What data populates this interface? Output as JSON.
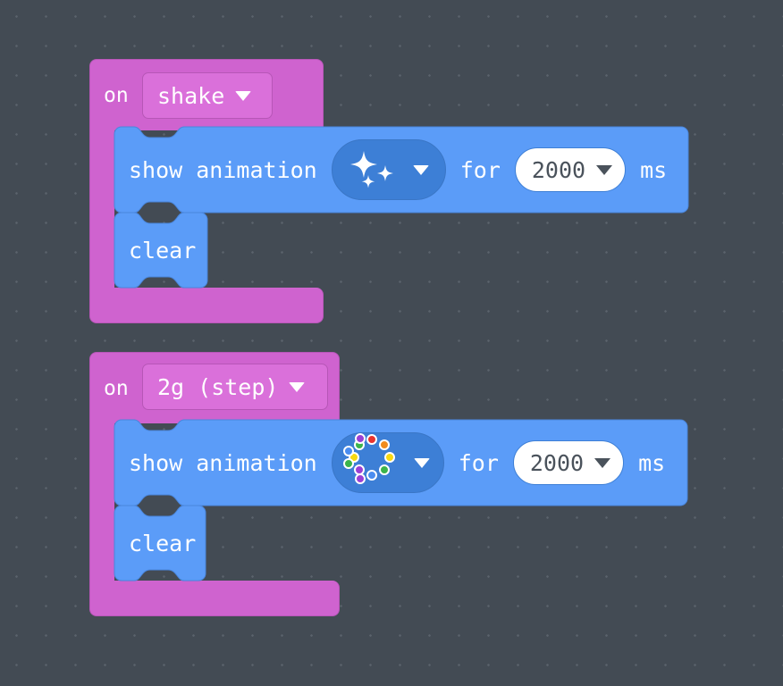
{
  "workspace": {
    "name": "makecode-blocks-workspace",
    "background_color": "#434b54",
    "grid_dot_color": "#5b636c",
    "grid_spacing_px": 33
  },
  "palette": {
    "event_block": "#cf63cf",
    "event_field": "#da70da",
    "statement_block": "#5b9cf8",
    "statement_field": "#3d7fd6",
    "number_field_bg": "#ffffff",
    "number_field_text": "#4a525b",
    "block_text": "#ffffff"
  },
  "scripts": [
    {
      "id": "script-on-shake",
      "event": {
        "prefix_label": "on",
        "selected_event": "shake",
        "dropdown_icon": "chevron-down-icon"
      },
      "statements": [
        {
          "id": "show-animation-sparkles",
          "label_before": "show animation",
          "animation": {
            "name": "sparkle-animation-icon",
            "dropdown_icon": "chevron-down-icon"
          },
          "label_middle": "for",
          "duration_value": "2000",
          "duration_dropdown_icon": "chevron-down-icon",
          "label_after": "ms"
        },
        {
          "id": "clear-1",
          "label": "clear"
        }
      ]
    },
    {
      "id": "script-on-2g-step",
      "event": {
        "prefix_label": "on",
        "selected_event": "2g (step)",
        "dropdown_icon": "chevron-down-icon"
      },
      "statements": [
        {
          "id": "show-animation-rainbow",
          "label_before": "show animation",
          "animation": {
            "name": "rainbow-cycle-animation-icon",
            "dropdown_icon": "chevron-down-icon",
            "dot_colors": [
              "#e8342f",
              "#f08b1d",
              "#f7d912",
              "#3cb44b",
              "#4a8df0",
              "#9b3fd4",
              "#f7d912",
              "#3cb44b",
              "#4a8df0",
              "#9b3fd4",
              "#ffffff",
              "#9b3fd4"
            ]
          },
          "label_middle": "for",
          "duration_value": "2000",
          "duration_dropdown_icon": "chevron-down-icon",
          "label_after": "ms"
        },
        {
          "id": "clear-2",
          "label": "clear"
        }
      ]
    }
  ]
}
